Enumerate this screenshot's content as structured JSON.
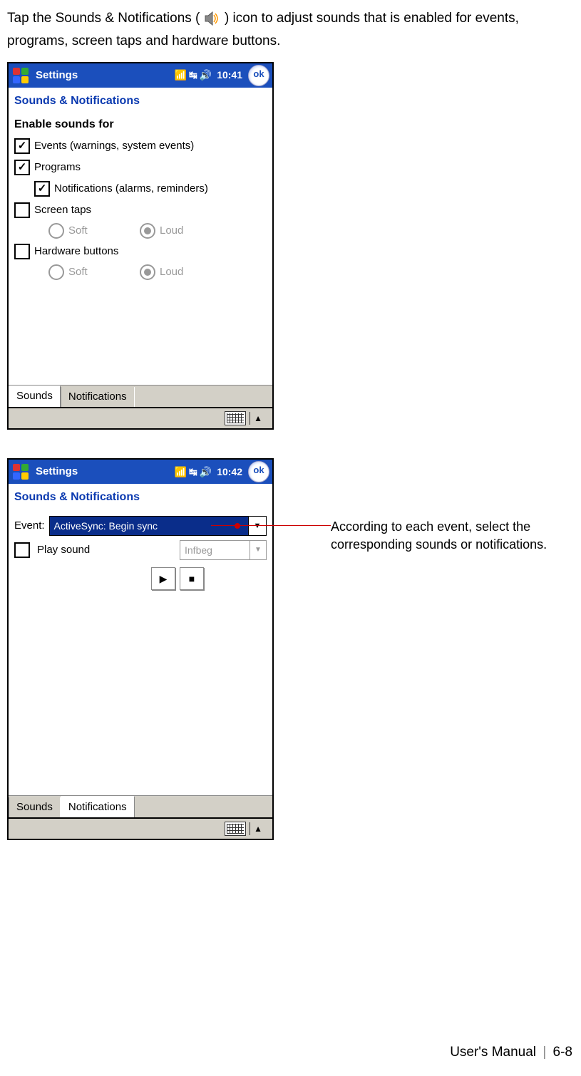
{
  "intro": {
    "part1": "Tap the Sounds & Notifications (",
    "part2": ") icon to adjust sounds that is enabled for events, programs, screen taps and hardware buttons."
  },
  "screen1": {
    "title": "Settings",
    "clock": "10:41",
    "ok": "ok",
    "subtitle": "Sounds & Notifications",
    "header": "Enable sounds for",
    "rows": {
      "events": {
        "label": "Events (warnings, system events)",
        "checked": true
      },
      "programs": {
        "label": "Programs",
        "checked": true
      },
      "notifications": {
        "label": "Notifications (alarms, reminders)",
        "checked": true
      },
      "screentaps": {
        "label": "Screen taps",
        "checked": false
      },
      "hardware": {
        "label": "Hardware buttons",
        "checked": false
      }
    },
    "radios": {
      "soft": "Soft",
      "loud": "Loud"
    },
    "tabs": {
      "sounds": "Sounds",
      "notifications": "Notifications"
    }
  },
  "screen2": {
    "title": "Settings",
    "clock": "10:42",
    "ok": "ok",
    "subtitle": "Sounds & Notifications",
    "event_label": "Event:",
    "event_value": "ActiveSync: Begin sync",
    "playsound_label": "Play sound",
    "sound_value": "Infbeg",
    "tabs": {
      "sounds": "Sounds",
      "notifications": "Notifications"
    }
  },
  "callout": "According to each event, select the corresponding sounds or notifications.",
  "footer": {
    "manual": "User's Manual",
    "page": "6-8"
  }
}
